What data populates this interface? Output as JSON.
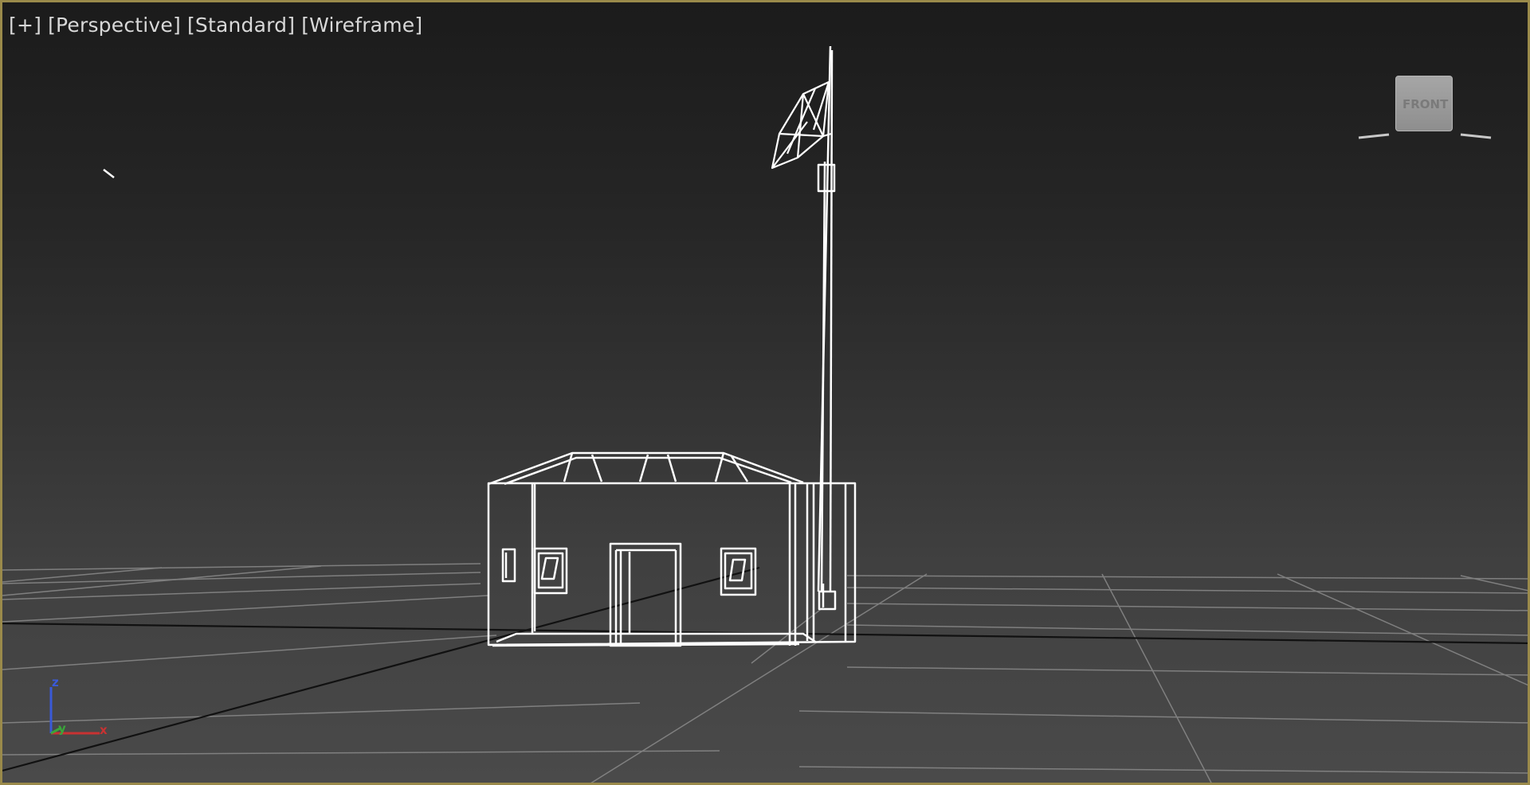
{
  "viewport": {
    "labels": [
      {
        "text": "[+]",
        "name": "viewport-menu-plus"
      },
      {
        "text": "[Perspective]",
        "name": "viewport-point-of-view"
      },
      {
        "text": "[Standard]",
        "name": "viewport-shading-preset"
      },
      {
        "text": "[Wireframe]",
        "name": "viewport-display-mode"
      }
    ],
    "border_color": "#9a8a4a"
  },
  "viewcube": {
    "face_label": "FRONT"
  },
  "axis_tripod": {
    "z_label": "z",
    "y_label": "y",
    "x_label": "x",
    "colors": {
      "x": "#c83232",
      "y": "#3aa63a",
      "z": "#3a5ad8"
    }
  },
  "scene": {
    "wire_color": "#ffffff",
    "grid_color": "#8a8a8a",
    "home_grid_axis_color": "#111111",
    "objects": [
      "building",
      "antenna-mast",
      "satellite-dish"
    ]
  }
}
